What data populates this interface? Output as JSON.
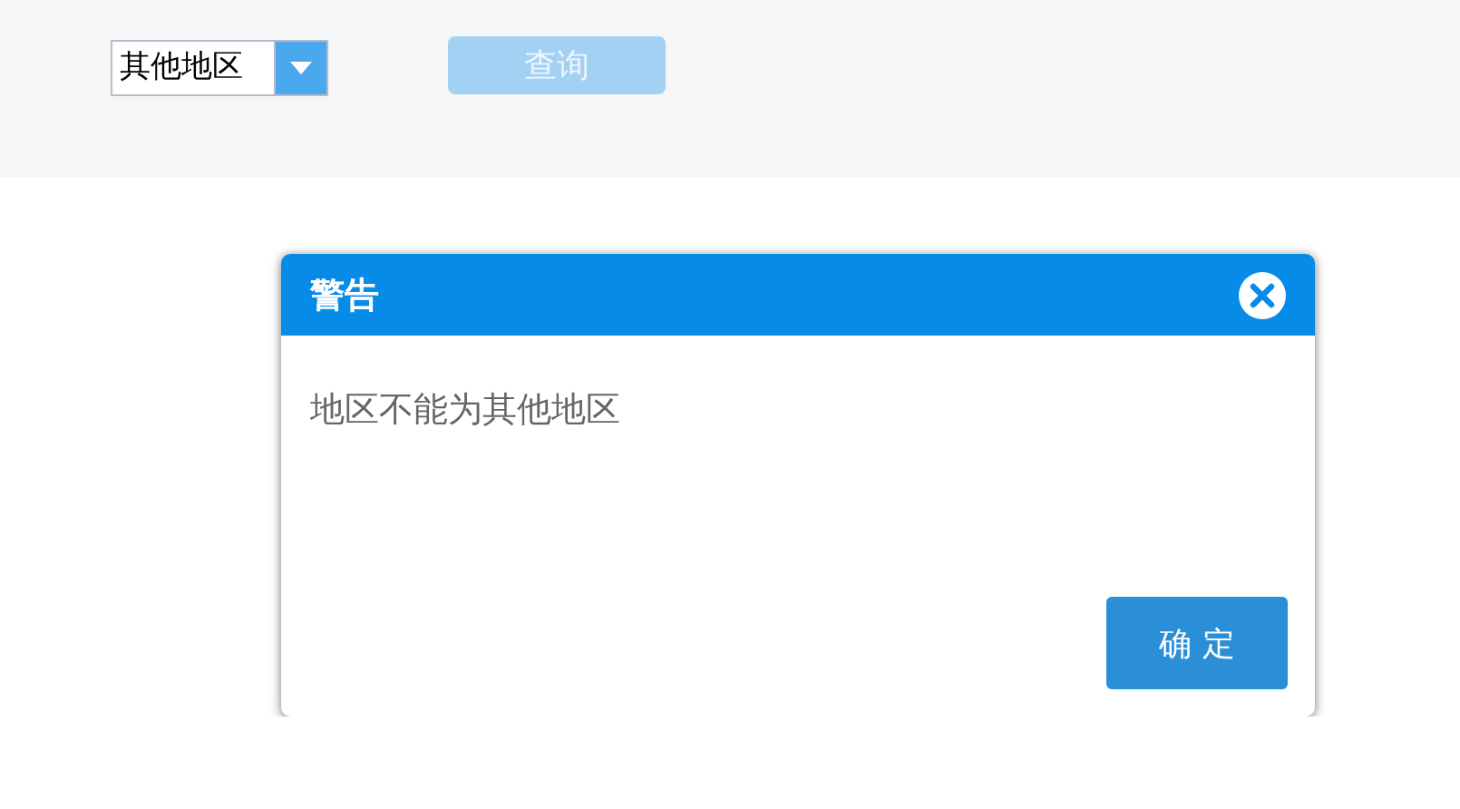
{
  "filter": {
    "region_select": {
      "value": "其他地区"
    },
    "query_button": {
      "label": "查询",
      "disabled": true
    }
  },
  "dialog": {
    "title": "警告",
    "message": "地区不能为其他地区",
    "confirm_button": "确 定"
  }
}
